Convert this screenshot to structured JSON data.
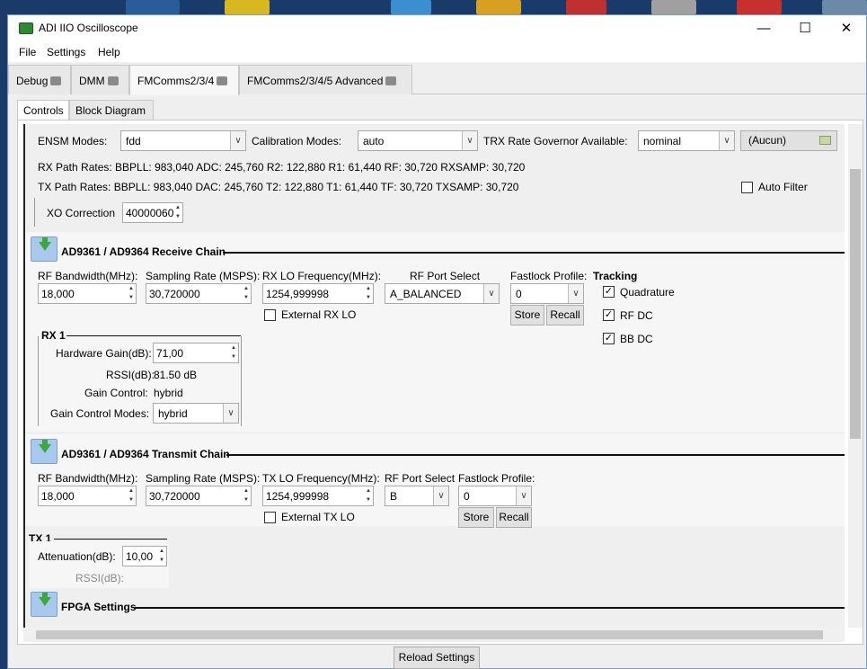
{
  "window": {
    "title": "ADI IIO Oscilloscope",
    "minimize": "—",
    "maximize": "☐",
    "close": "✕"
  },
  "menu": [
    "File",
    "Settings",
    "Help"
  ],
  "main_tabs": [
    "Debug",
    "DMM",
    "FMComms2/3/4",
    "FMComms2/3/4/5 Advanced"
  ],
  "sub_tabs": [
    "Controls",
    "Block Diagram"
  ],
  "global": {
    "ensm_label": "ENSM Modes:",
    "ensm_value": "fdd",
    "cal_label": "Calibration Modes:",
    "cal_value": "auto",
    "trx_label": "TRX Rate Governor Available:",
    "trx_value": "nominal",
    "file_value": "(Aucun)",
    "rx_rates": "RX Path Rates:  BBPLL: 983,040   ADC: 245,760   R2: 122,880   R1: 61,440   RF: 30,720   RXSAMP: 30,720",
    "tx_rates": "TX Path Rates:  BBPLL: 983,040   DAC: 245,760   T2: 122,880   T1: 61,440   TF: 30,720   TXSAMP: 30,720",
    "auto_filter": "Auto Filter",
    "xo_label": "XO Correction",
    "xo_value": "40000060"
  },
  "rx": {
    "title": "AD9361 / AD9364 Receive Chain",
    "bw_label": "RF Bandwidth(MHz):",
    "bw_value": "18,000",
    "sr_label": "Sampling Rate (MSPS):",
    "sr_value": "30,720000",
    "lo_label": "RX LO Frequency(MHz):",
    "lo_value": "1254,999998",
    "port_label": "RF Port Select",
    "port_value": "A_BALANCED",
    "fl_label": "Fastlock Profile:",
    "fl_value": "0",
    "store": "Store",
    "recall": "Recall",
    "ext_lo": "External RX LO",
    "tracking": "Tracking",
    "quad": "Quadrature",
    "rfdc": "RF DC",
    "bbdc": "BB DC",
    "rx1": "RX 1",
    "hg_label": "Hardware Gain(dB):",
    "hg_value": "71,00",
    "rssi_label": "RSSI(dB):",
    "rssi_value": "81.50 dB",
    "gc_label": "Gain Control:",
    "gc_value": "hybrid",
    "gcm_label": "Gain Control Modes:",
    "gcm_value": "hybrid"
  },
  "tx": {
    "title": "AD9361 / AD9364 Transmit Chain",
    "bw_label": "RF Bandwidth(MHz):",
    "bw_value": "18,000",
    "sr_label": "Sampling Rate (MSPS):",
    "sr_value": "30,720000",
    "lo_label": "TX LO Frequency(MHz):",
    "lo_value": "1254,999998",
    "port_label": "RF Port Select",
    "port_value": "B",
    "fl_label": "Fastlock Profile:",
    "fl_value": "0",
    "store": "Store",
    "recall": "Recall",
    "ext_lo": "External TX LO",
    "tx1": "TX 1",
    "att_label": "Attenuation(dB):",
    "att_value": "10,00",
    "rssi_label": "RSSI(dB):"
  },
  "fpga": {
    "title": "FPGA Settings"
  },
  "reload": "Reload Settings",
  "colors": {
    "accent": "#3ea83e",
    "expander": "#a8c8ec"
  }
}
